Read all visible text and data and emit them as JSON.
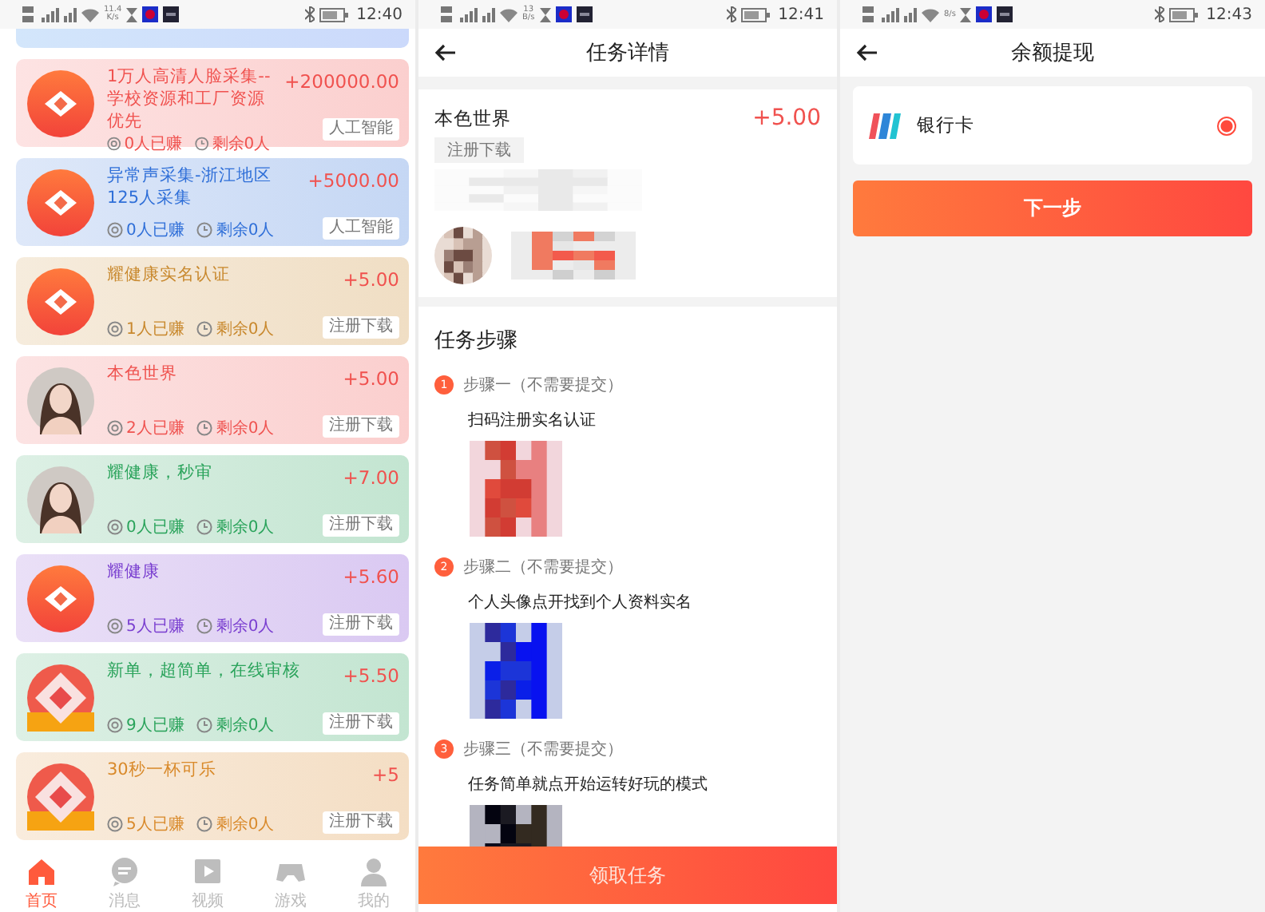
{
  "screens": [
    {
      "kind": "list",
      "status_bar": {
        "speed": "11.4\nK/s",
        "time": "12:40"
      },
      "tasks": [
        {
          "kind": "partial"
        },
        {
          "kind": "app",
          "color": "#f0524f",
          "title": "1万人高清人脸采集--学校资源和工厂资源优先",
          "earned": "0人已赚",
          "remaining": "剩余0人",
          "reward": "+200000.00",
          "tag": "人工智能"
        },
        {
          "kind": "app",
          "color": "#2f6fd8",
          "title": "异常声采集-浙江地区125人采集",
          "earned": "0人已赚",
          "remaining": "剩余0人",
          "reward": "+5000.00",
          "tag": "人工智能"
        },
        {
          "kind": "app",
          "color": "#c8882d",
          "title": "耀健康实名认证",
          "earned": "1人已赚",
          "remaining": "剩余0人",
          "reward": "+5.00",
          "tag": "注册下载"
        },
        {
          "color": "#ef5350",
          "title": "本色世界",
          "earned": "2人已赚",
          "remaining": "剩余0人",
          "reward": "+5.00",
          "tag": "注册下载"
        },
        {
          "color": "#2aa35b",
          "title": "耀健康，秒审",
          "earned": "0人已赚",
          "remaining": "剩余0人",
          "reward": "+7.00",
          "tag": "注册下载"
        },
        {
          "kind": "app",
          "color": "#7a3fd0",
          "title": "耀健康",
          "earned": "5人已赚",
          "remaining": "剩余0人",
          "reward": "+5.60",
          "tag": "注册下载"
        },
        {
          "kind": "app-alt",
          "color": "#2aa35b",
          "title": "新单，超简单，在线审核",
          "earned": "9人已赚",
          "remaining": "剩余0人",
          "reward": "+5.50",
          "tag": "注册下载"
        },
        {
          "kind": "app-alt",
          "color": "#d98a2b",
          "title": "30秒一杯可乐",
          "earned": "5人已赚",
          "remaining": "剩余0人",
          "reward": "+5",
          "tag": "注册下载"
        }
      ],
      "tab_bar": [
        {
          "label": "首页",
          "kind": "home",
          "selected": true
        },
        {
          "label": "消息",
          "kind": "chat",
          "selected": false
        },
        {
          "label": "视频",
          "kind": "video",
          "selected": false
        },
        {
          "label": "游戏",
          "kind": "game",
          "selected": false
        },
        {
          "label": "我的",
          "kind": "user",
          "selected": false
        }
      ]
    },
    {
      "kind": "detail",
      "status_bar": {
        "speed": "13\nB/s",
        "time": "12:41"
      },
      "title": "任务详情",
      "task": {
        "title": "本色世界",
        "reward": "+5.00",
        "tag": "注册下载"
      },
      "steps_heading": "任务步骤",
      "steps": [
        {
          "number": "1",
          "label": "步骤一（不需要提交）",
          "text": "扫码注册实名认证",
          "kind": "red"
        },
        {
          "number": "2",
          "label": "步骤二（不需要提交）",
          "text": "个人头像点开找到个人资料实名",
          "kind": "blue"
        },
        {
          "number": "3",
          "label": "步骤三（不需要提交）",
          "text": "任务简单就点开始运转好玩的模式",
          "kind": "dark"
        }
      ],
      "button": "领取任务"
    },
    {
      "kind": "withdraw",
      "status_bar": {
        "speed": "8/s",
        "time": "12:43"
      },
      "title": "余额提现",
      "methods": [
        {
          "label": "银行卡",
          "selected": true
        }
      ],
      "button": "下一步"
    }
  ]
}
